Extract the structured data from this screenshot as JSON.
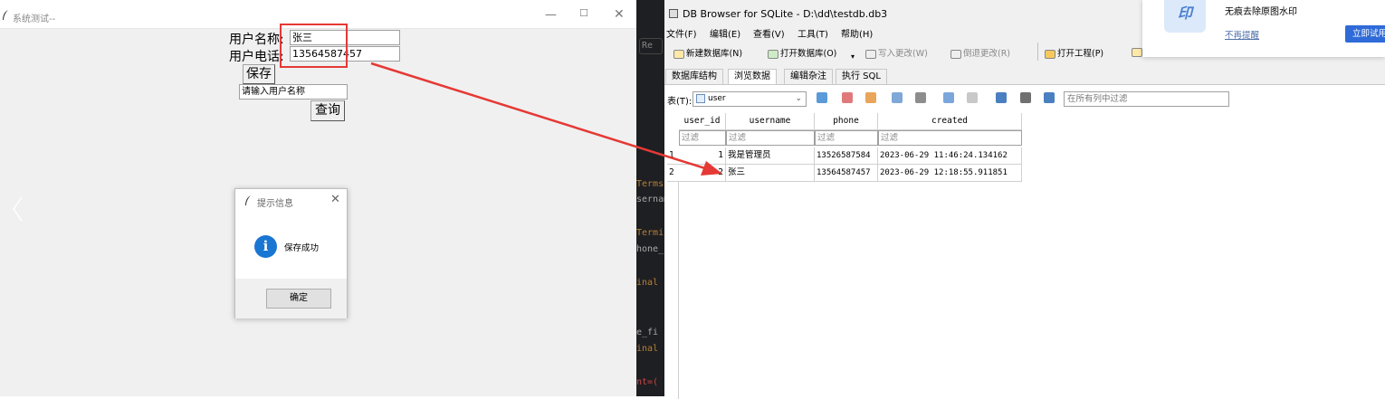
{
  "tk_window": {
    "title": "系统测试--",
    "label_name": "用户名称:",
    "label_phone": "用户电话:",
    "name_value": "张三",
    "phone_value": "13564587457",
    "save_label": "保存",
    "search_placeholder": "请输入用户名称",
    "query_label": "查询",
    "dialog": {
      "title": "提示信息",
      "message": "保存成功",
      "ok_label": "确定",
      "info_glyph": "i"
    }
  },
  "terminal": {
    "lines": [
      "Re",
      "Terms",
      "sernam",
      "Termi",
      "hone_",
      "inal",
      "e_fi",
      "inal",
      "nt=("
    ]
  },
  "db_browser": {
    "title": "DB Browser for SQLite - D:\\dd\\testdb.db3",
    "menu": [
      "文件(F)",
      "编辑(E)",
      "查看(V)",
      "工具(T)",
      "帮助(H)"
    ],
    "toolbar": {
      "new_db": "新建数据库(N)",
      "open_db": "打开数据库(O)",
      "write_changes": "写入更改(W)",
      "revert_changes": "倒退更改(R)",
      "open_project": "打开工程(P)"
    },
    "tabs": [
      "数据库结构",
      "浏览数据",
      "编辑杂注",
      "执行 SQL"
    ],
    "active_tab": "浏览数据",
    "table_label": "表(T):",
    "table_selected": "user",
    "filter_all_placeholder": "在所有列中过滤",
    "columns": [
      "user_id",
      "username",
      "phone",
      "created"
    ],
    "filter_placeholder": "过滤",
    "rows": [
      {
        "rownum": "1",
        "user_id": "1",
        "username": "我是管理员",
        "phone": "13526587584",
        "created": "2023-06-29 11:46:24.134162"
      },
      {
        "rownum": "2",
        "user_id": "2",
        "username": "张三",
        "phone": "13564587457",
        "created": "2023-06-29 12:18:55.911851"
      }
    ]
  },
  "notification": {
    "logo_text": "印",
    "message": "无痕去除原图水印",
    "dismiss": "不再提醒",
    "action": "立即试用"
  },
  "colors": {
    "annotation_red": "#e53935",
    "info_blue": "#1976d2"
  }
}
